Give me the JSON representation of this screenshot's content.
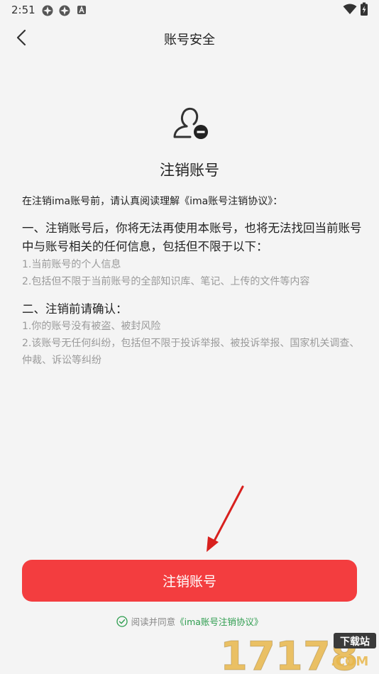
{
  "status_bar": {
    "time": "2:51"
  },
  "header": {
    "title": "账号安全"
  },
  "main": {
    "heading": "注销账号",
    "intro": "在注销ima账号前，请认真阅读理解《ima账号注销协议》：",
    "section1": {
      "title": "一、注销账号后，你将无法再使用本账号，也将无法找回当前账号中与账号相关的任何信息，包括但不限于以下：",
      "items": [
        "1.当前账号的个人信息",
        "2.包括但不限于当前账号的全部知识库、笔记、上传的文件等内容"
      ]
    },
    "section2": {
      "title": "二、注销前请确认：",
      "items": [
        "1.你的账号没有被盗、被封风险",
        "2.该账号无任何纠纷，包括但不限于投诉举报、被投诉举报、国家机关调查、仲裁、诉讼等纠纷"
      ]
    }
  },
  "footer": {
    "button_label": "注销账号",
    "agree_text": "阅读并同意",
    "agreement_link": "《ima账号注销协议》"
  },
  "watermark": {
    "site": "17178",
    "tag": "下载站",
    "domain": ".COM"
  },
  "colors": {
    "accent_red": "#f33d3f",
    "link_green": "#2e9d4f",
    "secondary_text": "#9a9a9a"
  }
}
